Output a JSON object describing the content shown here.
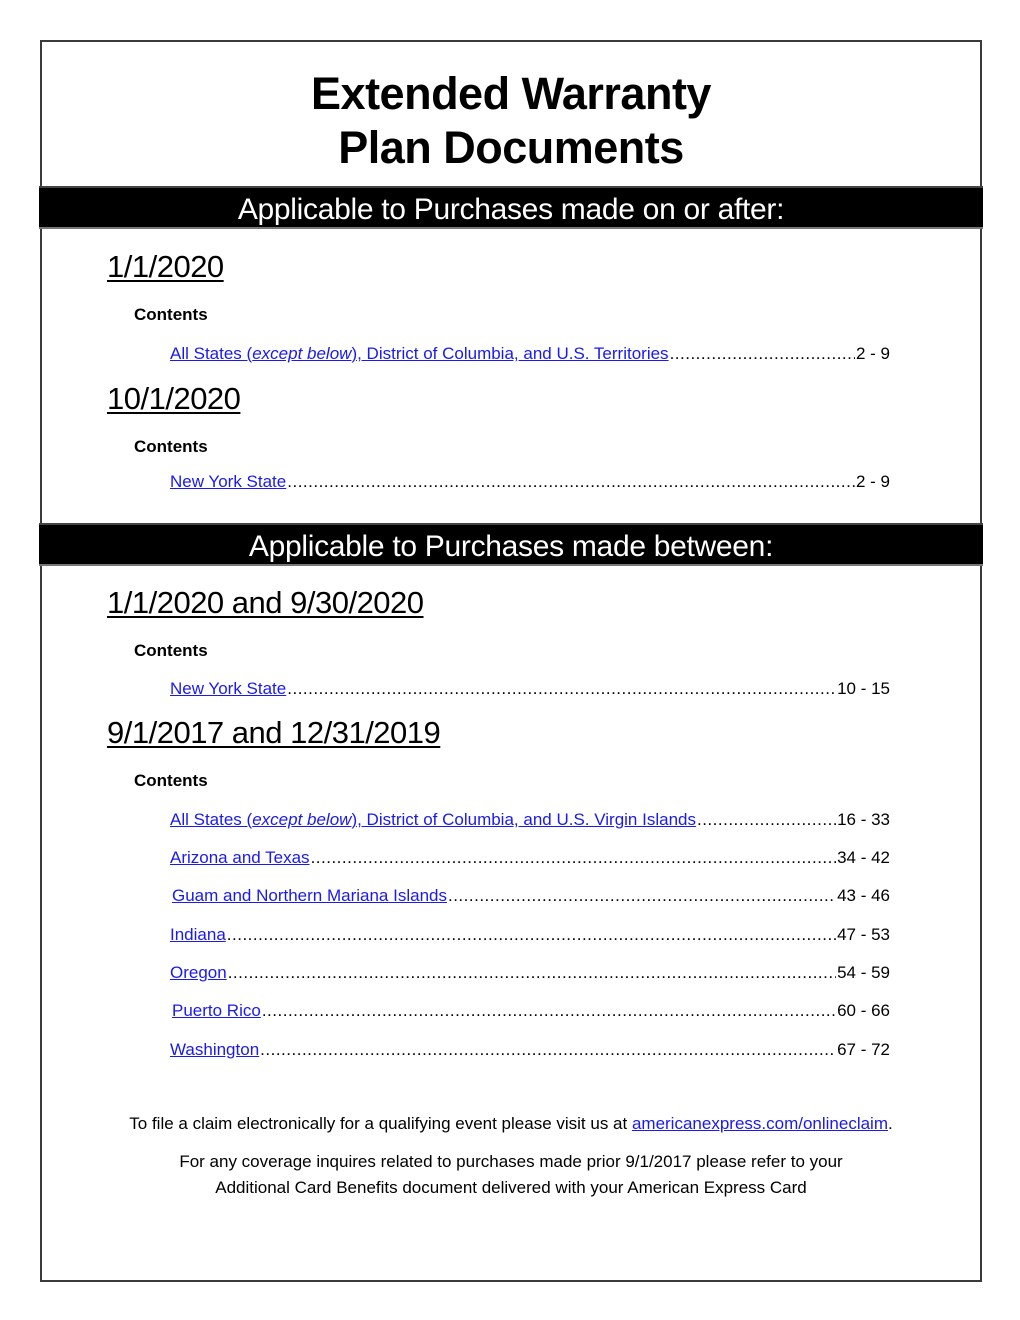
{
  "title": {
    "line1": "Extended Warranty",
    "line2": "Plan Documents"
  },
  "sections": [
    {
      "banner": "Applicable to Purchases made on or after:",
      "groups": [
        {
          "date": "1/1/2020",
          "contents_label": "Contents",
          "entries": [
            {
              "link_pre": "All States (",
              "link_italic": "except below",
              "link_post": "), District of Columbia, and U.S. Territories",
              "pages": "2 - 9"
            }
          ]
        },
        {
          "date": "10/1/2020",
          "contents_label": "Contents",
          "entries": [
            {
              "link_pre": "New York State",
              "link_italic": "",
              "link_post": "",
              "pages": "2 - 9"
            }
          ]
        }
      ]
    },
    {
      "banner": "Applicable to Purchases made between:",
      "groups": [
        {
          "date": "1/1/2020 and 9/30/2020",
          "contents_label": "Contents",
          "entries": [
            {
              "link_pre": "New York State",
              "link_italic": "",
              "link_post": "",
              "pages": "10 - 15"
            }
          ]
        },
        {
          "date": "9/1/2017 and 12/31/2019",
          "contents_label": "Contents",
          "entries": [
            {
              "link_pre": "All States (",
              "link_italic": "except below",
              "link_post": "), District of Columbia, and U.S. Virgin Islands",
              "pages": "16 - 33"
            },
            {
              "link_pre": "Arizona and Texas",
              "link_italic": "",
              "link_post": "",
              "pages": "34 - 42"
            },
            {
              "link_pre": "Guam and Northern Mariana Islands",
              "link_italic": "",
              "link_post": "",
              "pages": "43 - 46"
            },
            {
              "link_pre": "Indiana",
              "link_italic": "",
              "link_post": "",
              "pages": "47 - 53"
            },
            {
              "link_pre": "Oregon",
              "link_italic": "",
              "link_post": "",
              "pages": "54 - 59"
            },
            {
              "link_pre": "Puerto Rico",
              "link_italic": "",
              "link_post": "",
              "pages": "60 - 66"
            },
            {
              "link_pre": "Washington",
              "link_italic": "",
              "link_post": "",
              "pages": "67 - 72"
            }
          ]
        }
      ]
    }
  ],
  "footer": {
    "claim_text": "To file a claim electronically for a qualifying event please visit us at ",
    "claim_link": "americanexpress.com/onlineclaim",
    "claim_end": ".",
    "prior_line1": "For any coverage inquires related to purchases made prior 9/1/2017 please refer to your",
    "prior_line2": "Additional Card Benefits document delivered with your American Express Card"
  },
  "colors": {
    "link": "#1a1aee",
    "banner_bg": "#000000",
    "banner_text": "#ffffff"
  }
}
